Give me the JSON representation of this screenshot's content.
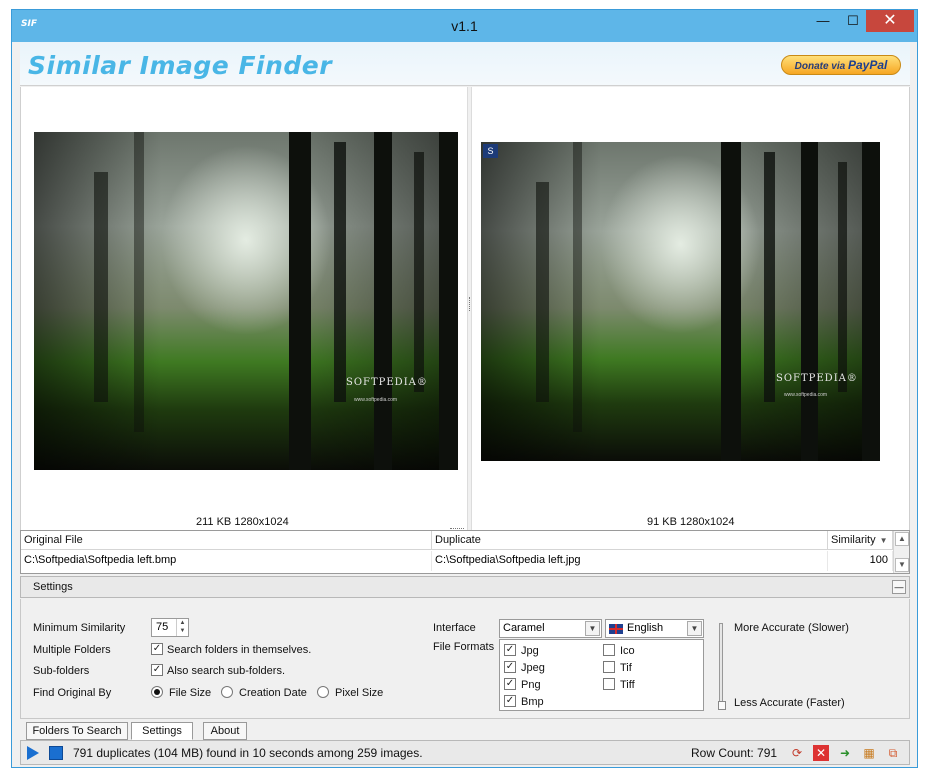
{
  "window": {
    "icon_text": "SIF",
    "title": "v1.1",
    "min": "—",
    "max": "☐",
    "close": "✕"
  },
  "header": {
    "brand": "Similar Image Finder",
    "donate_prefix": "Donate via",
    "donate_brand": "PayPal"
  },
  "viewer": {
    "original_info": "211 KB 1280x1024",
    "duplicate_info": "91 KB 1280x1024",
    "duplicate_badge": "S",
    "watermark": "SOFTPEDIA®",
    "watermark_url": "www.softpedia.com"
  },
  "grid": {
    "columns": [
      "Original File",
      "Duplicate",
      "Similarity"
    ],
    "rows": [
      {
        "original": "C:\\Softpedia\\Softpedia left.bmp",
        "duplicate": "C:\\Softpedia\\Softpedia left.jpg",
        "similarity": "100"
      }
    ]
  },
  "settings": {
    "title": "Settings",
    "min_similarity_label": "Minimum Similarity",
    "min_similarity_value": "75",
    "multiple_folders_label": "Multiple Folders",
    "multiple_folders_option": "Search folders in themselves.",
    "subfolders_label": "Sub-folders",
    "subfolders_option": "Also search sub-folders.",
    "find_original_label": "Find Original By",
    "find_original_options": [
      "File Size",
      "Creation Date",
      "Pixel Size"
    ],
    "find_original_selected": "File Size",
    "interface_label": "Interface",
    "interface_value": "Caramel",
    "language_value": "English",
    "file_formats_label": "File Formats",
    "formats": [
      {
        "name": "Jpg",
        "checked": true
      },
      {
        "name": "Jpeg",
        "checked": true
      },
      {
        "name": "Png",
        "checked": true
      },
      {
        "name": "Bmp",
        "checked": true
      },
      {
        "name": "Ico",
        "checked": false
      },
      {
        "name": "Tif",
        "checked": false
      },
      {
        "name": "Tiff",
        "checked": false
      }
    ],
    "accuracy_high": "More Accurate (Slower)",
    "accuracy_low": "Less Accurate (Faster)",
    "accuracy_level": 0.0
  },
  "tabs": [
    "Folders To Search",
    "Settings",
    "About"
  ],
  "status": {
    "message": "791 duplicates (104 MB) found in 10 seconds among 259 images.",
    "row_count": "Row Count: 791"
  }
}
